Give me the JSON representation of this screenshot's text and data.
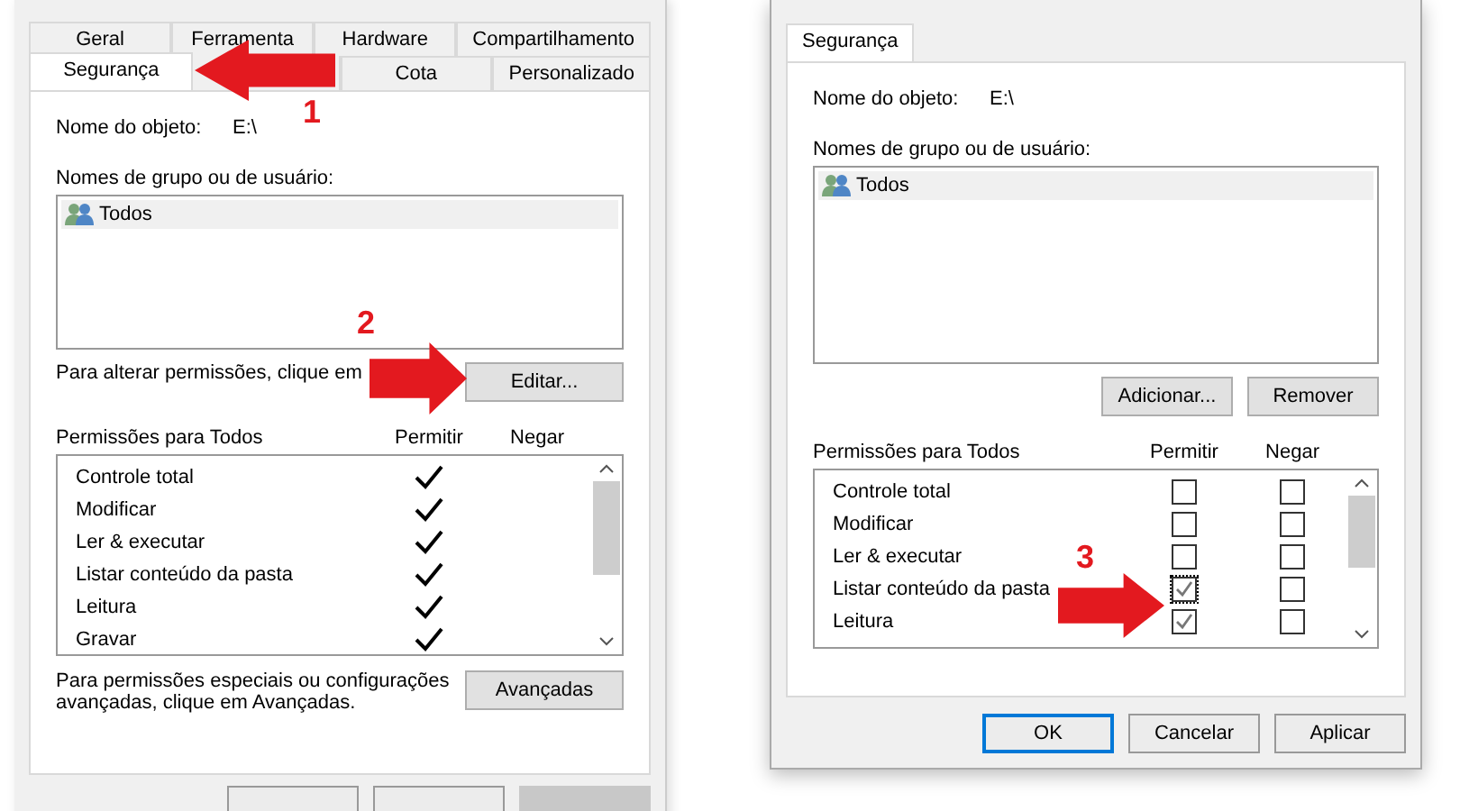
{
  "dialogs": [
    {
      "kind": "ticks",
      "tab_rows": [
        [
          {
            "label": "Geral",
            "selected": false
          },
          {
            "label": "Ferramenta",
            "selected": false
          },
          {
            "label": "Hardware",
            "selected": false
          },
          {
            "label": "Compartilhamento",
            "selected": false
          }
        ],
        [
          {
            "label": "Segurança",
            "selected": true
          },
          {
            "label": "Cota",
            "selected": false
          },
          {
            "label": "Personalizado",
            "selected": false
          }
        ]
      ],
      "object_label": "Nome do objeto:",
      "object_value": "E:\\",
      "users_label": "Nomes de grupo ou de usuário:",
      "users": [
        {
          "name": "Todos",
          "selected": true
        }
      ],
      "edit_hint": "Para alterar permissões, clique em",
      "edit_buttons": [
        "Editar..."
      ],
      "permissions_label": "Permissões para Todos",
      "allow_label": "Permitir",
      "deny_label": "Negar",
      "permissions": [
        {
          "name": "Controle total",
          "allow": true
        },
        {
          "name": "Modificar",
          "allow": true
        },
        {
          "name": "Ler & executar",
          "allow": true
        },
        {
          "name": "Listar conteúdo da pasta",
          "allow": true
        },
        {
          "name": "Leitura",
          "allow": true
        },
        {
          "name": "Gravar",
          "allow": true
        }
      ],
      "advanced_hint": "Para permissões especiais ou configurações avançadas, clique em Avançadas.",
      "advanced_button": "Avançadas",
      "footer_buttons": [
        {
          "disabled": false,
          "default": false
        },
        {
          "disabled": false,
          "default": false
        },
        {
          "disabled": true,
          "default": false
        }
      ]
    },
    {
      "kind": "checkboxes",
      "tab_rows": [
        [
          {
            "label": "Segurança",
            "selected": true
          }
        ]
      ],
      "object_label": "Nome do objeto:",
      "object_value": "E:\\",
      "users_label": "Nomes de grupo ou de usuário:",
      "users": [
        {
          "name": "Todos",
          "selected": true
        }
      ],
      "edit_buttons": [
        "Adicionar...",
        "Remover"
      ],
      "permissions_label": "Permissões para Todos",
      "allow_label": "Permitir",
      "deny_label": "Negar",
      "permissions": [
        {
          "name": "Controle total",
          "allow": false,
          "deny": false,
          "focused": false
        },
        {
          "name": "Modificar",
          "allow": false,
          "deny": false,
          "focused": false
        },
        {
          "name": "Ler & executar",
          "allow": false,
          "deny": false,
          "focused": false
        },
        {
          "name": "Listar conteúdo da pasta",
          "allow": true,
          "deny": false,
          "focused": true
        },
        {
          "name": "Leitura",
          "allow": true,
          "deny": false,
          "focused": false
        }
      ],
      "footer_buttons": [
        {
          "label": "OK",
          "disabled": false,
          "default": true
        },
        {
          "label": "Cancelar",
          "disabled": false,
          "default": false
        },
        {
          "label": "Aplicar",
          "disabled": false,
          "default": false
        }
      ]
    }
  ],
  "annotations": [
    {
      "label": "1",
      "kind": "left"
    },
    {
      "label": "2",
      "kind": "right"
    },
    {
      "label": "3",
      "kind": "right"
    }
  ]
}
